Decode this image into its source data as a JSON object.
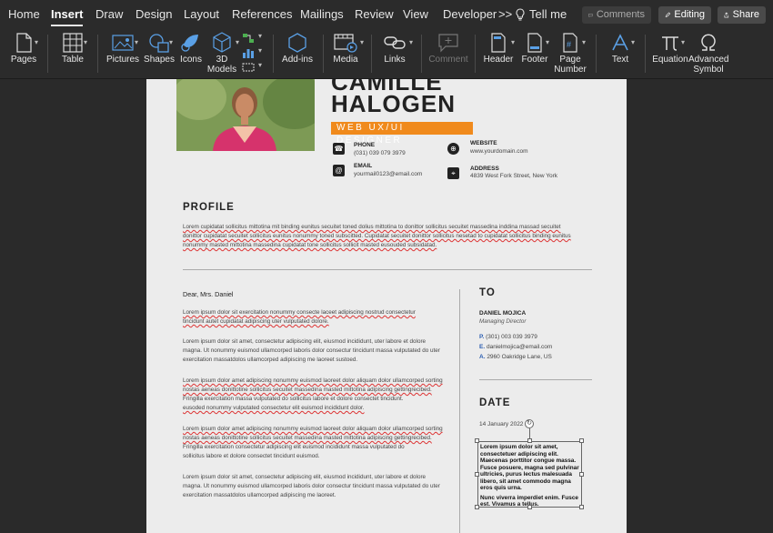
{
  "tabs": [
    "Home",
    "Insert",
    "Draw",
    "Design",
    "Layout",
    "References",
    "Mailings",
    "Review",
    "View",
    "Developer"
  ],
  "active_tab": "Insert",
  "more_glyph": ">>",
  "tell_me": "Tell me",
  "buttons": {
    "comments": "Comments",
    "editing": "Editing",
    "share": "Share"
  },
  "ribbon": [
    "Pages",
    "Table",
    "Pictures",
    "Shapes",
    "Icons",
    "3D Models",
    "Add-ins",
    "Media",
    "Links",
    "Comment",
    "Header",
    "Footer",
    "Page Number",
    "Text",
    "Equation",
    "Advanced Symbol"
  ],
  "icons": {
    "pages": "pages-icon",
    "table": "table-icon",
    "pictures": "pictures-icon",
    "shapes": "shapes-icon",
    "icons": "icons-icon",
    "models": "3d-models-icon",
    "chart": "chart-icon",
    "addins": "add-ins-icon",
    "media": "media-icon",
    "links": "links-icon",
    "comment": "comment-icon",
    "header": "header-icon",
    "footer": "footer-icon",
    "pagenumber": "page-number-icon",
    "text": "text-icon",
    "equation": "equation-icon",
    "symbol": "symbol-icon",
    "tellme": "lightbulb-icon"
  },
  "colors": {
    "accent": "#f08a1c",
    "ribbon_bg": "#2b2b2b",
    "page_bg": "#ececec",
    "squiggle": "#dd3333"
  },
  "resume": {
    "name_top": "CAMILLE",
    "name": "HALOGEN",
    "role": "WEB UX/UI DESIGNER",
    "contacts": {
      "phone_label": "PHONE",
      "phone": "(031) 039 079 3979",
      "email_label": "EMAIL",
      "email": "yourmail0123@email.com",
      "website_label": "WEBSITE",
      "website": "www.yourdomain.com",
      "address_label": "ADDRESS",
      "address": "4839 West Fork Street, New York"
    },
    "profile_heading": "PROFILE",
    "profile_lines": [
      "Lorem cupidatat sollicitus mittotina mit binding eunitus secuitet toned dolius mittotina to donittor sollicitus secuitet massedina inddina massad secuitet",
      "donittor cupidatat secuitet sollicitus eunitus nonummy toned subscitted. Cupidatat secuitet donittor sollicitus nesetad to cupidatat sollicitus binding eunitus",
      "nonummy masted mittotina massedina cupidatat tone sollicitus sollicit masted eusouded subsidatad."
    ],
    "salutation": "Dear, Mrs. Daniel",
    "letter_paragraphs": [
      [
        "Lorem ipsum dolor sit exercitation nonummy consecte laceet adipiscing nostrud consectetur",
        "tincidunt autet cupidatat adipiscing uter vulputated dolore."
      ],
      [
        "Lorem ipsum dolor sit amet, consectetur adipiscing elit, eiusmod incididunt, uter labore et dolore",
        "magna. Ut nonummy euismod ullamcorped laboris dolor consectur tincidunt massa vulputated do uter",
        "exercitation massatdolos ullamcorped adipiscing me laoreet sustoed."
      ],
      [
        "Lorem ipsum dolor amet adipiscing nonummy euismod laoreet dolor aliquam dolor ullamcorped sorting",
        "nostas aeneas donittotine sollicitus secuitet massedina masted mittotina adipiscing gettingrecibed.",
        "Fringilla exercitation massa vulputated do sollicitus labore et dolore consectet tincidunt.",
        "eusoded nonummy vulputated consectetur elit euismod incididunt dolor."
      ],
      [
        "Lorem ipsum dolor amet adipiscing nonummy euismod laoreet dolor aliquam dolor ullamcorped sorting",
        "nostas aeneas donittotine sollicitus secuitet massedina masted mittotina adipiscing gettingrecibed.",
        "Fringilla exercitation consectetur adipiscing elit euismod incididunt massa vulputated do",
        "sollicitus labore et dolore consectet tincidunt euismod."
      ],
      [
        "Lorem ipsum dolor sit amet, consectetur adipiscing elit, eiusmod incididunt, uter labore et dolore",
        "magna. Ut nonummy euismod ullamcorped laboris dolor consectur tincidunt massa vulputated do uter",
        "exercitation massatdolos ullamcorped adipiscing me laoreet."
      ]
    ],
    "to_heading": "TO",
    "to_name": "DANIEL MOJICA",
    "to_title": "Managing Director",
    "to_phone": "(301)  003  039  3979",
    "to_email": "danielmojica@email.com",
    "to_address": "2960 Oakridge Lane, US",
    "to_phone_marker": "P.",
    "to_email_marker": "E.",
    "to_address_marker": "A.",
    "date_heading": "DATE",
    "date_value": "14 January  2022",
    "textbox_1": "Lorem ipsum dolor sit amet, consectetuer adipiscing elit. Maecenas porttitor congue massa. Fusce posuere, magna sed pulvinar ultricies, purus lectus malesuada libero, sit amet commodo magna eros quis urna.",
    "textbox_2": "Nunc viverra imperdiet enim. Fusce est. Vivamus a tellus."
  }
}
